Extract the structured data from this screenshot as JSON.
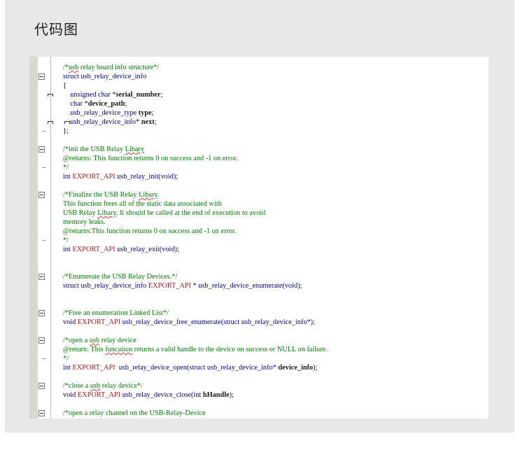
{
  "page": {
    "title": "代码图"
  },
  "code": {
    "lines": [
      [
        {
          "t": "/*",
          "c": "comment"
        },
        {
          "t": "usb",
          "c": "comment",
          "sq": true
        },
        {
          "t": " relay board info structure*/",
          "c": "comment"
        }
      ],
      [
        {
          "t": "struct usb_relay_device_info",
          "c": "kw"
        }
      ],
      [
        {
          "t": "{",
          "c": "plain"
        }
      ],
      [
        {
          "t": "    unsigned char *",
          "c": "kw"
        },
        {
          "t": "serial_number",
          "c": "bold"
        },
        {
          "t": ";",
          "c": "plain"
        }
      ],
      [
        {
          "t": "    char *",
          "c": "kw"
        },
        {
          "t": "device_path",
          "c": "bold"
        },
        {
          "t": ";",
          "c": "plain"
        }
      ],
      [
        {
          "t": "    usb_relay_device_type ",
          "c": "kw"
        },
        {
          "t": "type",
          "c": "bold"
        },
        {
          "t": ";",
          "c": "plain"
        }
      ],
      [
        {
          "t": "    usb_relay_device_info* ",
          "c": "kw"
        },
        {
          "t": "next",
          "c": "bold"
        },
        {
          "t": ";",
          "c": "plain"
        }
      ],
      [
        {
          "t": "};",
          "c": "plain"
        }
      ],
      [],
      [
        {
          "t": "/*init the USB Relay ",
          "c": "comment"
        },
        {
          "t": "Libary",
          "c": "comment",
          "sq": true
        }
      ],
      [
        {
          "t": "@returns: This function returns 0 on success and -1 on error.",
          "c": "comment"
        }
      ],
      [
        {
          "t": "*/",
          "c": "comment"
        }
      ],
      [
        {
          "t": "int ",
          "c": "kw"
        },
        {
          "t": "EXPORT_API",
          "c": "macro"
        },
        {
          "t": " usb_relay_init(void);",
          "c": "kw"
        }
      ],
      [],
      [
        {
          "t": "/*Finalize the USB Relay ",
          "c": "comment"
        },
        {
          "t": "Libary",
          "c": "comment",
          "sq": true
        },
        {
          "t": ".",
          "c": "comment"
        }
      ],
      [
        {
          "t": "This function frees all of the static data associated with",
          "c": "comment"
        }
      ],
      [
        {
          "t": "USB Relay ",
          "c": "comment"
        },
        {
          "t": "Libary",
          "c": "comment",
          "sq": true
        },
        {
          "t": ". It should be called at the end of execution to avoid",
          "c": "comment"
        }
      ],
      [
        {
          "t": "memory leaks.",
          "c": "comment"
        }
      ],
      [
        {
          "t": "@returns:This function returns 0 on success and -1 on error.",
          "c": "comment"
        }
      ],
      [
        {
          "t": "*/",
          "c": "comment"
        }
      ],
      [
        {
          "t": "int ",
          "c": "kw"
        },
        {
          "t": "EXPORT_API",
          "c": "macro"
        },
        {
          "t": " usb_relay_exit(void);",
          "c": "kw"
        }
      ],
      [],
      [],
      [
        {
          "t": "/*Enumerate the USB Relay Devices.*/",
          "c": "comment"
        }
      ],
      [
        {
          "t": "struct usb_relay_device_info ",
          "c": "kw"
        },
        {
          "t": "EXPORT_API",
          "c": "macro"
        },
        {
          "t": " * usb_relay_device_enumerate(void);",
          "c": "kw"
        }
      ],
      [],
      [],
      [
        {
          "t": "/*Free an enumeration Linked List*/",
          "c": "comment"
        }
      ],
      [
        {
          "t": "void ",
          "c": "kw"
        },
        {
          "t": "EXPORT_API",
          "c": "macro"
        },
        {
          "t": " usb_relay_device_free_enumerate(struct usb_relay_device_info*);",
          "c": "kw"
        }
      ],
      [],
      [
        {
          "t": "/*open a ",
          "c": "comment"
        },
        {
          "t": "usb",
          "c": "comment",
          "sq": true
        },
        {
          "t": " relay device",
          "c": "comment"
        }
      ],
      [
        {
          "t": "@return: This ",
          "c": "comment"
        },
        {
          "t": "funcation",
          "c": "comment",
          "sq": true
        },
        {
          "t": " returns a valid handle to the device on success or NULL on failure.",
          "c": "comment"
        }
      ],
      [
        {
          "t": "*/",
          "c": "comment"
        }
      ],
      [
        {
          "t": "int ",
          "c": "kw"
        },
        {
          "t": "EXPORT_API",
          "c": "macro"
        },
        {
          "t": "  usb_relay_device_open(struct usb_relay_device_info* ",
          "c": "kw"
        },
        {
          "t": "device_info",
          "c": "bold"
        },
        {
          "t": ");",
          "c": "kw"
        }
      ],
      [],
      [
        {
          "t": "/*close a ",
          "c": "comment"
        },
        {
          "t": "usb",
          "c": "comment",
          "sq": true
        },
        {
          "t": " relay device*/",
          "c": "comment"
        }
      ],
      [
        {
          "t": "void ",
          "c": "kw"
        },
        {
          "t": "EXPORT_API",
          "c": "macro"
        },
        {
          "t": " usb_relay_device_close(int ",
          "c": "kw"
        },
        {
          "t": "hHandle",
          "c": "bold"
        },
        {
          "t": ");",
          "c": "kw"
        }
      ],
      [],
      [
        {
          "t": "/*open a relay channel on the USB-Relay-Device",
          "c": "comment"
        }
      ]
    ]
  }
}
